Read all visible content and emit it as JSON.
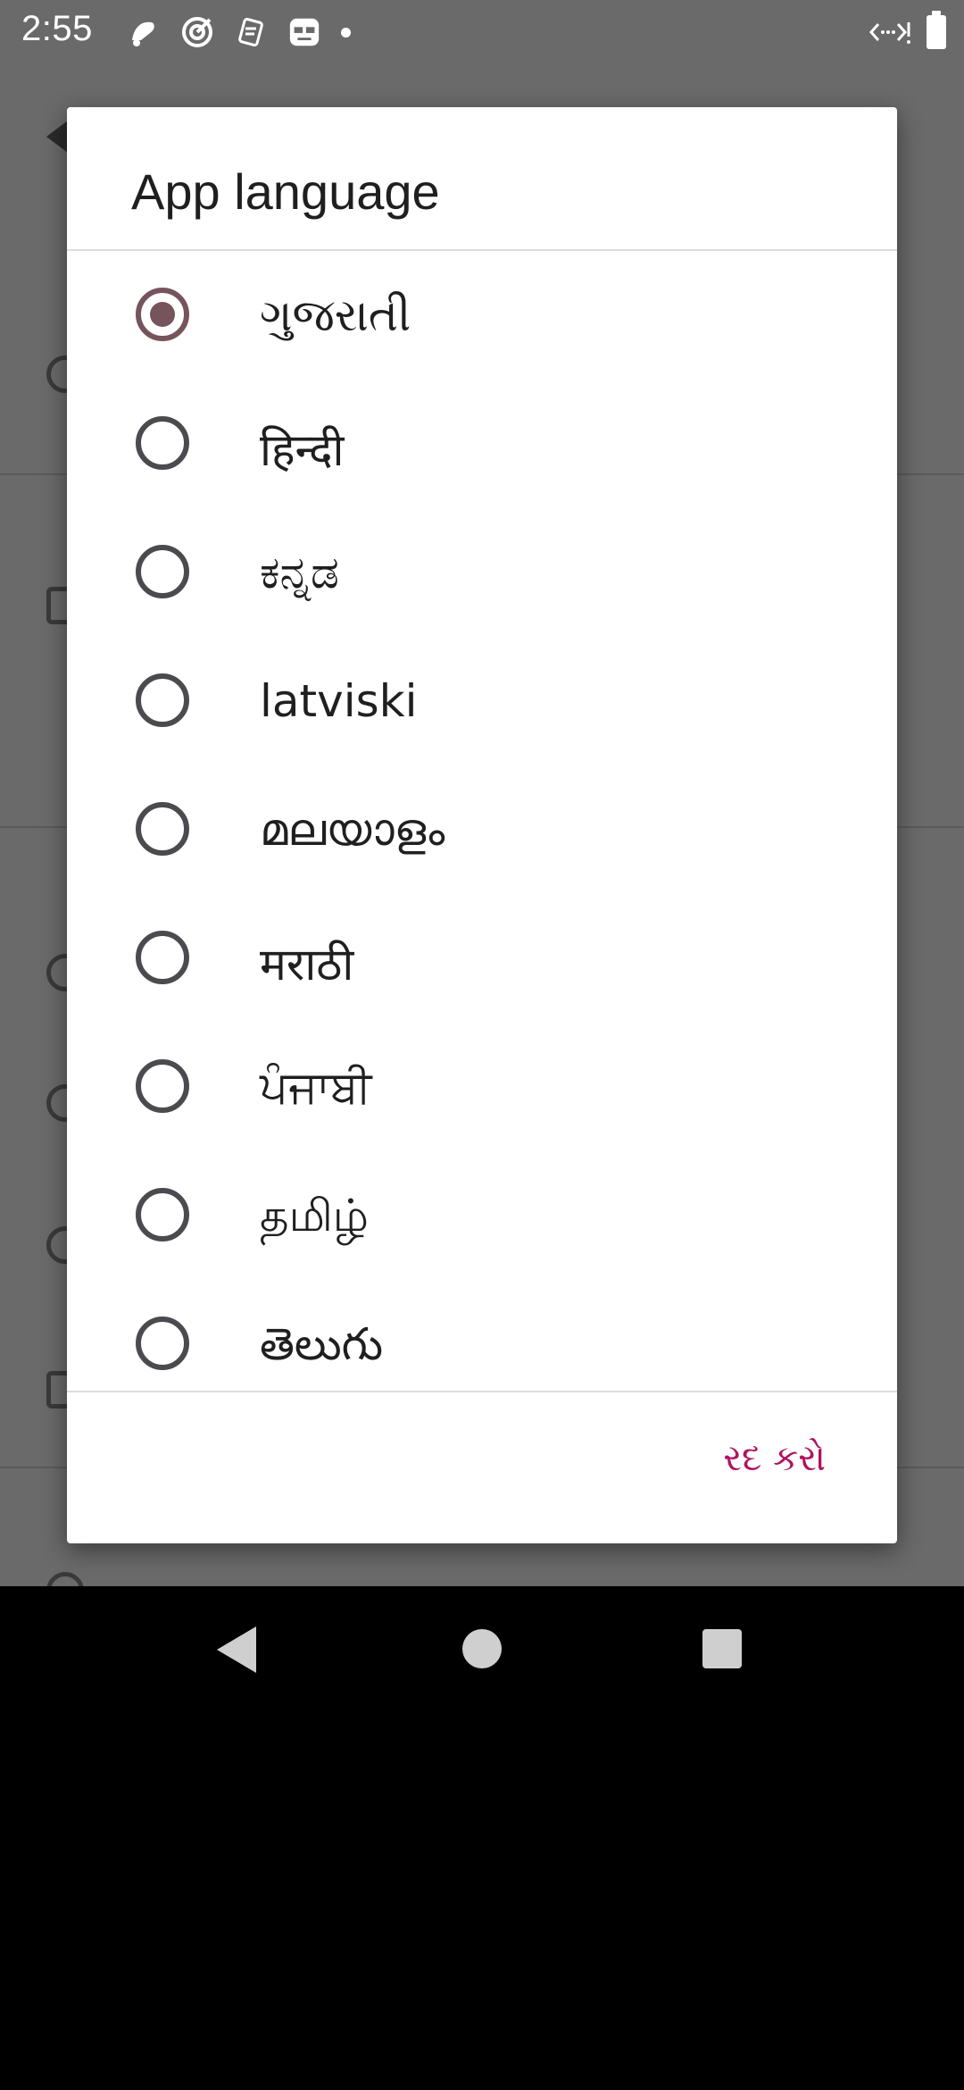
{
  "status_bar": {
    "time": "2:55",
    "left_icons": [
      "notification-icon",
      "target-icon",
      "sim-card-icon",
      "game-icon",
      "dot-icon"
    ],
    "right_icons": [
      "data-transfer-icon",
      "battery-icon"
    ]
  },
  "dialog": {
    "title": "App language",
    "options": [
      {
        "label": "ગુજરાતી",
        "selected": true
      },
      {
        "label": "हिन्दी",
        "selected": false
      },
      {
        "label": "ಕನ್ನಡ",
        "selected": false
      },
      {
        "label": "latviski",
        "selected": false
      },
      {
        "label": "മലയാളം",
        "selected": false
      },
      {
        "label": "मराठी",
        "selected": false
      },
      {
        "label": "ਪੰਜਾਬੀ",
        "selected": false
      },
      {
        "label": "தமிழ்",
        "selected": false
      },
      {
        "label": "తెలుగు",
        "selected": false
      }
    ],
    "cancel_label": "રદ કરો"
  },
  "colors": {
    "accent": "#b0135f",
    "radio_selected": "#76545b",
    "scrim": "#6a6a6a"
  },
  "nav_bar": {
    "icons": [
      "back-icon",
      "home-icon",
      "recents-icon"
    ]
  }
}
